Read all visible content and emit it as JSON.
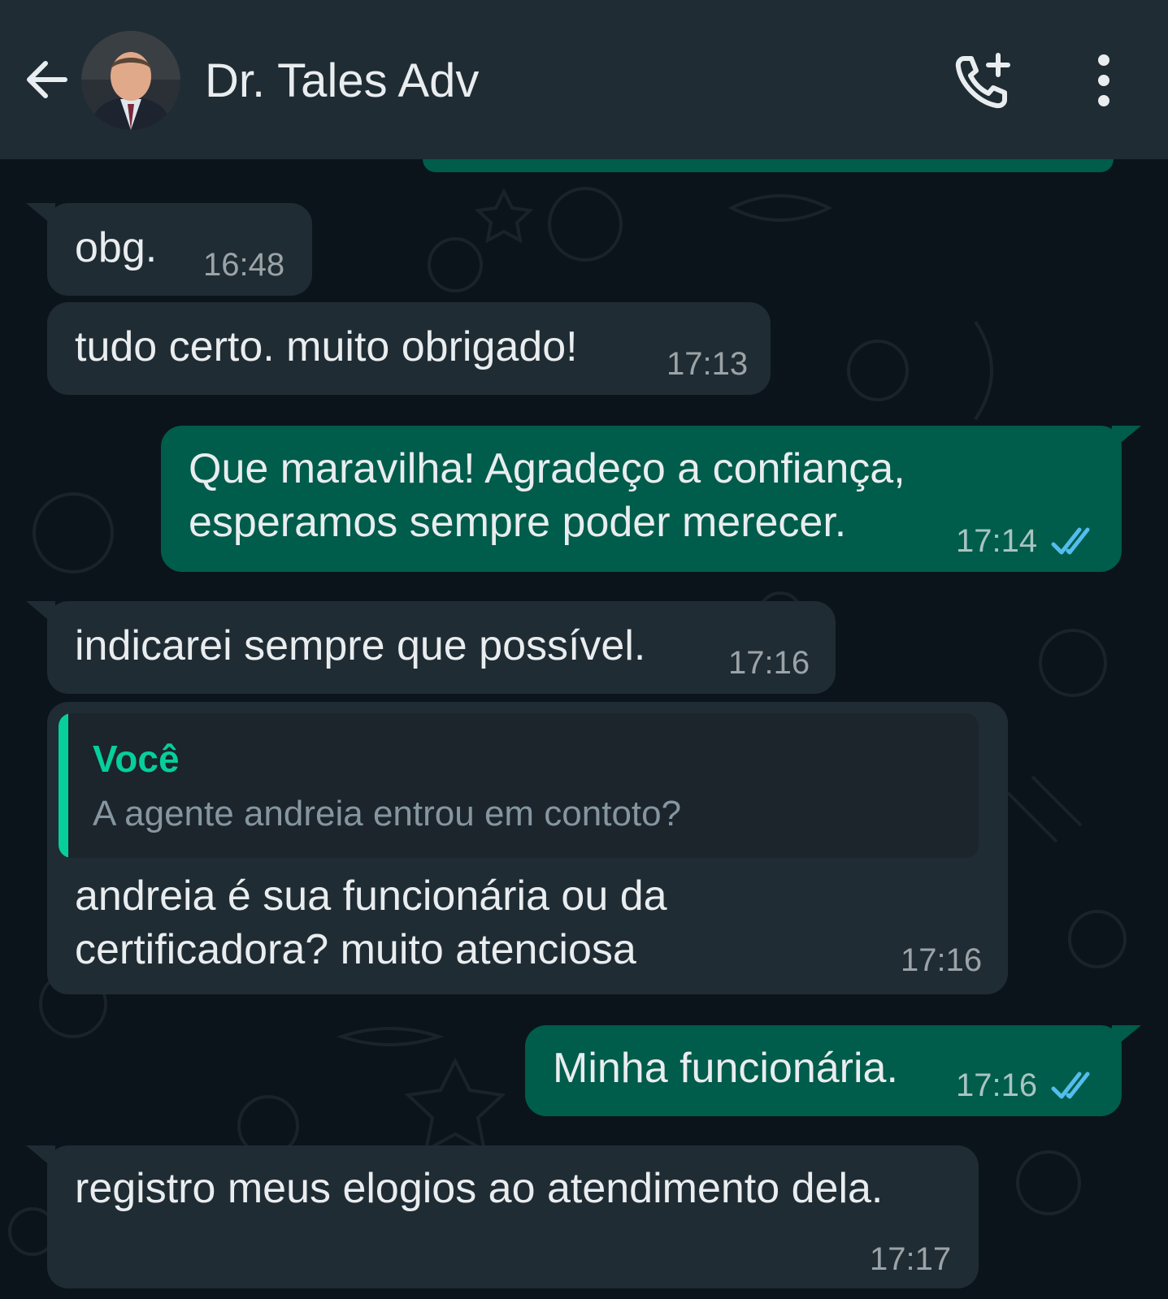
{
  "header": {
    "back_icon": "arrow-left-icon",
    "contact_name": "Dr. Tales Adv",
    "call_icon": "phone-plus-icon",
    "menu_icon": "more-vertical-icon"
  },
  "colors": {
    "header_bg": "#1f2c34",
    "chat_bg": "#0b141a",
    "incoming_bubble": "#202c33",
    "outgoing_bubble": "#005c4b",
    "read_ticks": "#53bdeb",
    "quote_accent": "#06cf9c"
  },
  "messages": [
    {
      "direction": "in",
      "text": "obg.",
      "time": "16:48"
    },
    {
      "direction": "in",
      "text": "tudo certo. muito obrigado!",
      "time": "17:13"
    },
    {
      "direction": "out",
      "text": "Que maravilha! Agradeço a confiança,\nesperamos sempre poder merecer.",
      "time": "17:14",
      "status": "read"
    },
    {
      "direction": "in",
      "text": "indicarei sempre que possível.",
      "time": "17:16"
    },
    {
      "direction": "in",
      "quote": {
        "author": "Você",
        "text": "A agente andreia entrou em contoto?"
      },
      "text": "andreia é sua funcionária ou da\ncertificadora? muito atenciosa",
      "time": "17:16"
    },
    {
      "direction": "out",
      "text": "Minha funcionária.",
      "time": "17:16",
      "status": "read"
    },
    {
      "direction": "in",
      "text": "registro meus elogios ao atendimento dela.",
      "time": "17:17"
    }
  ]
}
